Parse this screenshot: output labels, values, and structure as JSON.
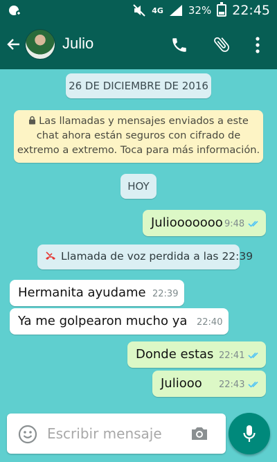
{
  "status_bar": {
    "network": "4G",
    "battery": "32%",
    "battery_level": 0.32,
    "time": "22:45",
    "icons": [
      "notification-icon",
      "mute-icon",
      "signal-icon",
      "battery-icon"
    ]
  },
  "header": {
    "contact_name": "Julio",
    "icons": [
      "back-arrow-icon",
      "avatar",
      "phone-icon",
      "paperclip-icon",
      "more-vert-icon"
    ]
  },
  "chat": {
    "date_chip": "26 DE DICIEMBRE DE 2016",
    "security_notice": {
      "lines": [
        "Las llamadas y mensajes enviados a este",
        "chat ahora están seguros con cifrado de",
        "extremo a extremo. Toca para más información."
      ]
    },
    "today_chip": "HOY",
    "missed_call": "Llamada de voz perdida a las 22:39",
    "messages": [
      {
        "direction": "out",
        "text": "Juliooooooo",
        "time": "9:48",
        "read": true
      },
      {
        "direction": "in",
        "text": "Hermanita ayudame",
        "time": "22:39"
      },
      {
        "direction": "in",
        "text": "Ya me golpearon mucho ya",
        "time": "22:40"
      },
      {
        "direction": "out",
        "text": "Donde estas",
        "time": "22:41",
        "read": true
      },
      {
        "direction": "out",
        "text": "Juliooo",
        "time": "22:43",
        "read": true
      }
    ]
  },
  "composer": {
    "placeholder": "Escribir mensaje",
    "value": ""
  },
  "colors": {
    "header": "#075e54",
    "chat_background": "#5fcfcf",
    "outgoing_bubble": "#dcf8c6",
    "incoming_bubble": "#ffffff",
    "read_ticks": "#4fc3f7",
    "mic_button": "#00897b",
    "missed_call_icon": "#e53935"
  }
}
